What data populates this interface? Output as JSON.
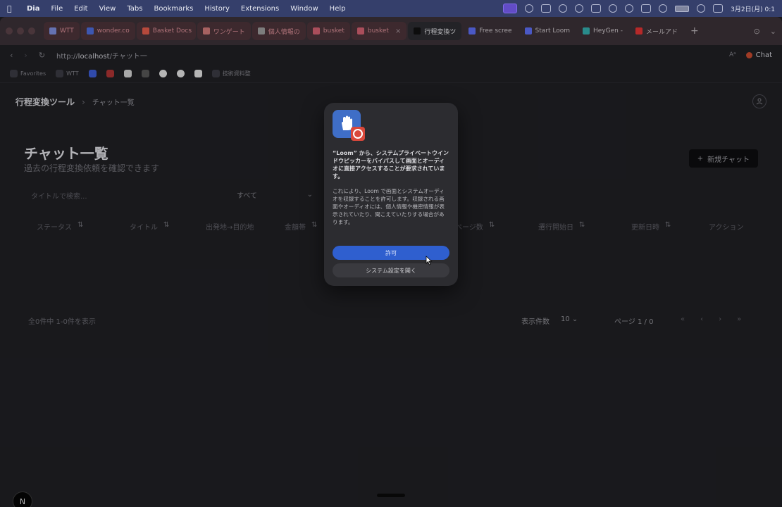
{
  "menubar": {
    "app": "Dia",
    "items": [
      "File",
      "Edit",
      "View",
      "Tabs",
      "Bookmarks",
      "History",
      "Extensions",
      "Window",
      "Help"
    ],
    "clock": "3月2日(月) 0:1"
  },
  "tabs": [
    {
      "label": "WTT",
      "style": "pink",
      "color": "#7c8bd9"
    },
    {
      "label": "wonder.co",
      "style": "pink",
      "color": "#4b6bd8"
    },
    {
      "label": "Basket Docs",
      "style": "pink",
      "color": "#e05a4a"
    },
    {
      "label": "ワンゲート",
      "style": "pink",
      "color": "#c77"
    },
    {
      "label": "個人情報の",
      "style": "pink",
      "color": "#999"
    },
    {
      "label": "busket",
      "style": "pink",
      "color": "#d06070"
    },
    {
      "label": "busket",
      "style": "pink",
      "color": "#d06070"
    },
    {
      "label": "行程変換ツ",
      "style": "active",
      "color": "#111"
    },
    {
      "label": "Free scree",
      "style": "plain",
      "color": "#5b6cf0"
    },
    {
      "label": "Start Loom",
      "style": "plain",
      "color": "#5b6cf0"
    },
    {
      "label": "HeyGen -",
      "style": "plain",
      "color": "#3aa"
    },
    {
      "label": "メールアド",
      "style": "plain",
      "color": "#d33"
    }
  ],
  "address": {
    "url_prefix": "http://",
    "url_host": "localhost",
    "url_suffix": "/チャット一",
    "chat_label": "Chat"
  },
  "bookmarks": {
    "favorites": "Favorites",
    "folder": "WTT",
    "last": "技術資料整"
  },
  "page": {
    "breadcrumb_root": "行程変換ツール",
    "breadcrumb_sep": "›",
    "breadcrumb_current": "チャット一覧",
    "title": "チャット一覧",
    "subtitle": "過去の行程変換依頼を確認できます",
    "new_chat": "新規チャット",
    "search_placeholder": "タイトルで検索...",
    "filter_value": "すべて",
    "columns": [
      "ステータス",
      "タイトル",
      "出発地→目的地",
      "金額帯",
      "ページ数",
      "遷行開始日",
      "更新日時",
      "アクション"
    ],
    "sort_glyph": "⇅",
    "count_text": "全0件中 1-0件を表示",
    "page_size_label": "表示件数",
    "page_size_value": "10",
    "page_info": "ページ 1 / 0",
    "pager": [
      "«",
      "‹",
      "›",
      "»"
    ]
  },
  "dialog": {
    "title": "“Loom” から、システムプライベートウインドウピッカーをバイパスして画面とオーディオに直接アクセスすることが要求されています。",
    "body": "これにより、Loom で画面とシステムオーディオを収録することを許可します。収録される画面やオーディオには、個人情報や機密情報が表示されていたり、聞こえていたりする場合があります。",
    "allow": "許可",
    "open_settings": "システム設定を開く"
  },
  "badge": "N"
}
